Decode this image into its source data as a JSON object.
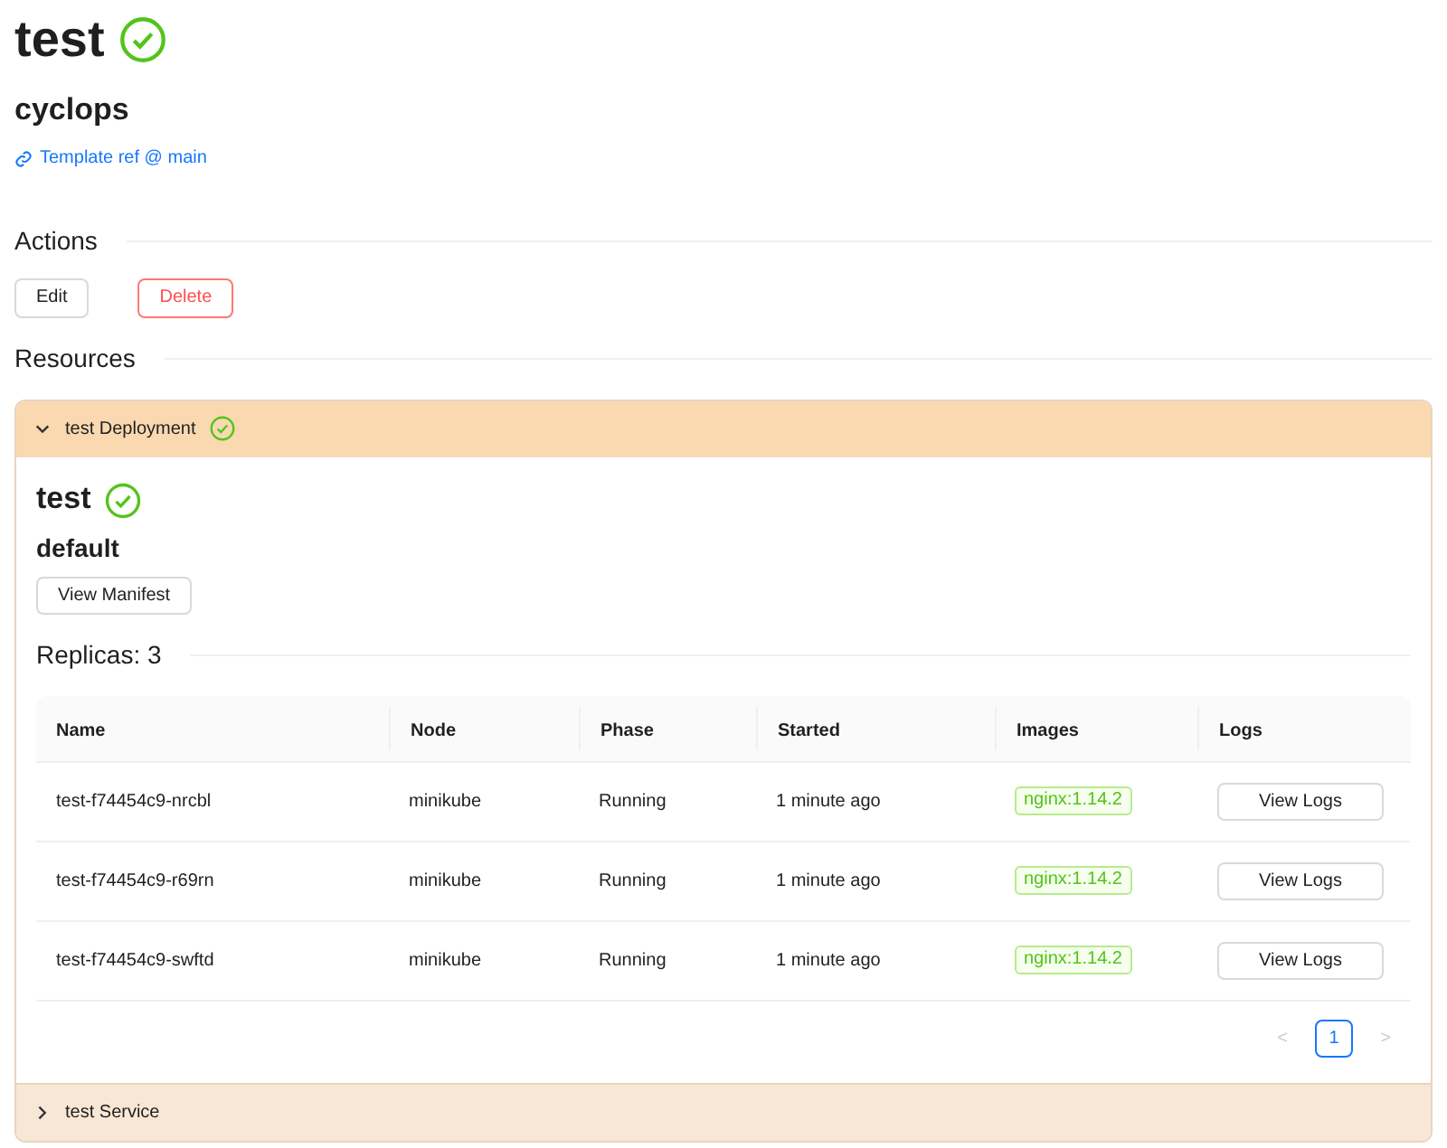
{
  "title": "test",
  "title_healthy": true,
  "namespace": "cyclops",
  "template_link": "Template ref @ main",
  "actions": {
    "heading": "Actions",
    "buttons": [
      {
        "label": "Edit",
        "kind": "default"
      },
      {
        "label": "Delete",
        "kind": "danger"
      }
    ]
  },
  "resources": {
    "heading": "Resources",
    "panels": [
      {
        "header": "test Deployment",
        "healthy": true,
        "expanded": true,
        "name": "test",
        "name_healthy": true,
        "namespace": "default",
        "manifest_button": "View Manifest",
        "replicas_heading": "Replicas: 3",
        "table": {
          "columns": [
            "Name",
            "Node",
            "Phase",
            "Started",
            "Images",
            "Logs"
          ],
          "rows": [
            {
              "name": "test-f74454c9-nrcbl",
              "node": "minikube",
              "phase": "Running",
              "started": "1 minute ago",
              "image": "nginx:1.14.2",
              "logs_button": "View Logs"
            },
            {
              "name": "test-f74454c9-r69rn",
              "node": "minikube",
              "phase": "Running",
              "started": "1 minute ago",
              "image": "nginx:1.14.2",
              "logs_button": "View Logs"
            },
            {
              "name": "test-f74454c9-swftd",
              "node": "minikube",
              "phase": "Running",
              "started": "1 minute ago",
              "image": "nginx:1.14.2",
              "logs_button": "View Logs"
            }
          ]
        },
        "pagination": {
          "prev": "<",
          "pages": [
            {
              "label": "1",
              "selected": true
            }
          ],
          "next": ">"
        }
      },
      {
        "header": "test Service",
        "healthy": false,
        "expanded": false
      }
    ]
  }
}
